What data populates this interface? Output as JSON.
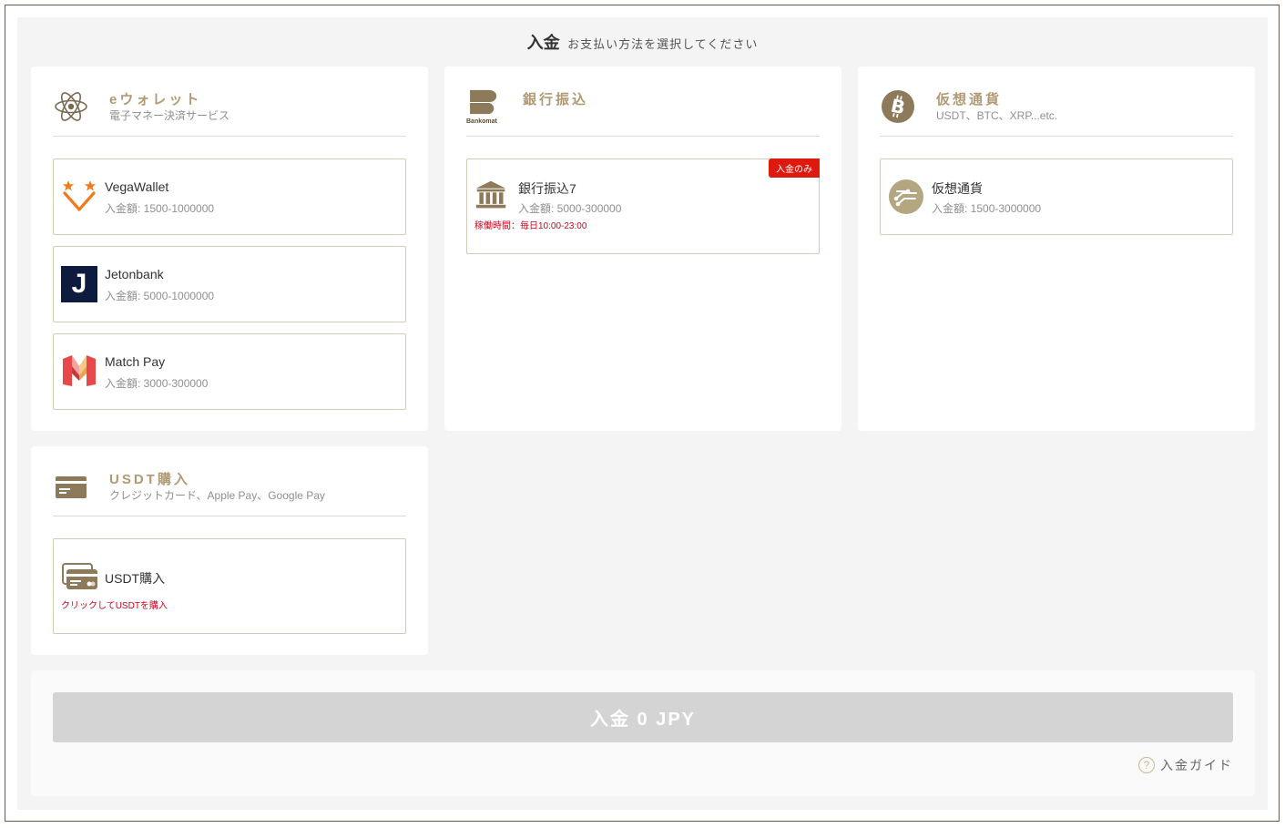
{
  "header": {
    "title": "入金",
    "subtitle": "お支払い方法を選択してください"
  },
  "panels": {
    "ewallet": {
      "title": "eウォレット",
      "desc": "電子マネー決済サービス",
      "icon": "atom-icon",
      "cards": [
        {
          "name": "VegaWallet",
          "range": "入金額: 1500-1000000"
        },
        {
          "name": "Jetonbank",
          "range": "入金額: 5000-1000000",
          "logo_letter": "J"
        },
        {
          "name": "Match Pay",
          "range": "入金額: 3000-300000"
        }
      ]
    },
    "bank": {
      "title": "銀行振込",
      "desc": "",
      "logo_text": "Bankomat",
      "icon": "bankomat-icon",
      "cards": [
        {
          "name": "銀行振込7",
          "range": "入金額: 5000-300000",
          "note": "稼働時間：毎日10:00-23:00",
          "badge": "入金のみ"
        }
      ]
    },
    "crypto": {
      "title": "仮想通貨",
      "desc": "USDT、BTC、XRP...etc.",
      "icon": "bitcoin-icon",
      "cards": [
        {
          "name": "仮想通貨",
          "range": "入金額: 1500-3000000"
        }
      ]
    },
    "usdt": {
      "title": "USDT購入",
      "desc": "クレジットカード、Apple Pay、Google Pay",
      "icon": "credit-card-icon",
      "cards": [
        {
          "name": "USDT購入",
          "note": "クリックしてUSDTを購入"
        }
      ]
    }
  },
  "footer": {
    "deposit_button": "入金 0 JPY",
    "guide_label": "入金ガイド",
    "guide_icon_glyph": "?"
  },
  "colors": {
    "accent": "#b09a73",
    "card_border": "#d2c9b6",
    "alert": "#d0021b",
    "badge": "#e0190f",
    "button_disabled": "#d4d4d4"
  }
}
